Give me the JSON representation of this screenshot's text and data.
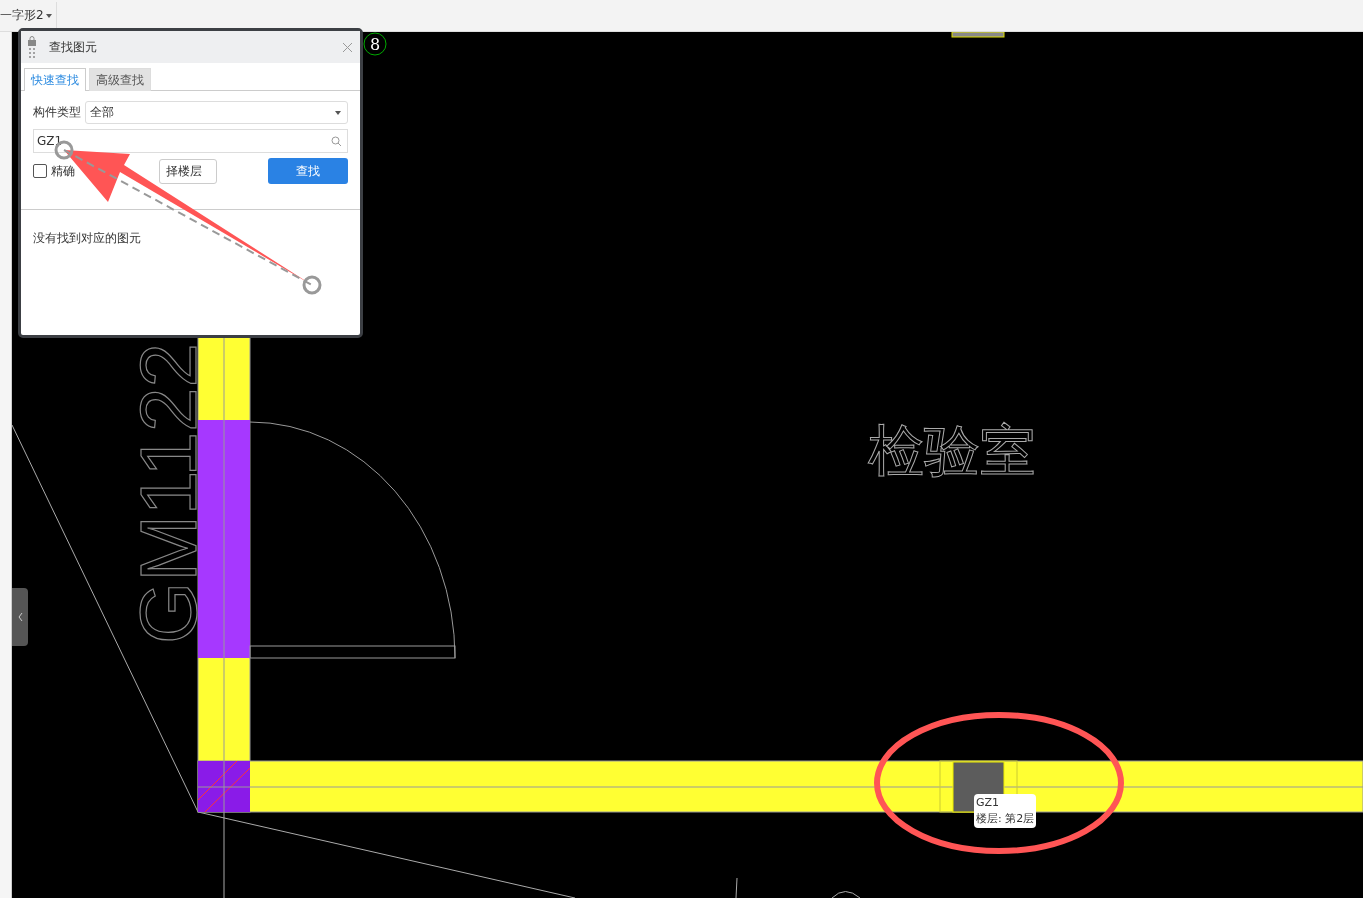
{
  "toolbar": {
    "dropdown_label": "一字形2"
  },
  "dialog": {
    "title": "查找图元",
    "tabs": [
      {
        "label": "快速查找",
        "selected": true
      },
      {
        "label": "高级查找",
        "selected": false
      }
    ],
    "type_label": "构件类型",
    "type_value": "全部",
    "search_value": "GZ1",
    "exact_match": {
      "label": "精确",
      "checked": false
    },
    "floor_button": "择楼层",
    "find_button": "查找",
    "message": "没有找到对应的图元"
  },
  "canvas": {
    "axis_marker": "8",
    "door_label": "GM1122",
    "room_label": "检验室",
    "tooltip": {
      "name": "GZ1",
      "floor": "楼层: 第2层"
    }
  }
}
